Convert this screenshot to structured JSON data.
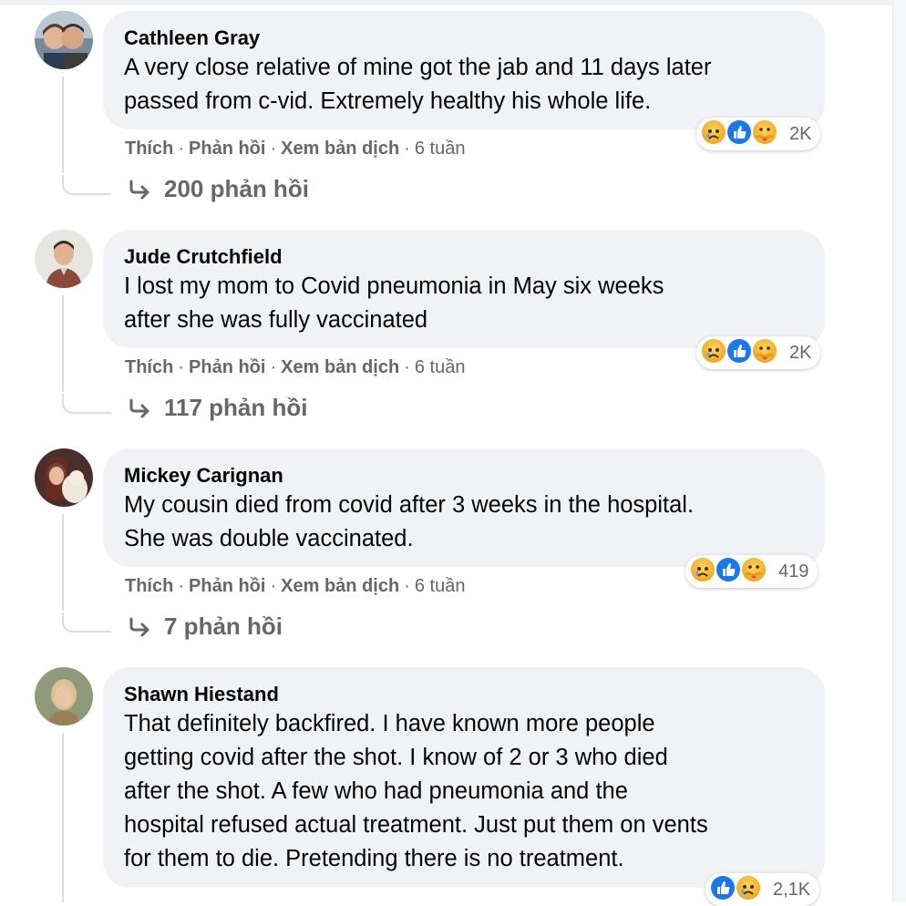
{
  "comments": [
    {
      "author": "Cathleen Gray",
      "lines": [
        "A very close relative of mine got the jab and 11 days later",
        "passed from c-vid. Extremely healthy his whole life."
      ],
      "actions": {
        "like": "Thích",
        "reply": "Phản hồi",
        "translate": "Xem bản dịch",
        "time": "6 tuần"
      },
      "reaction_count": "2K",
      "reaction_icons": [
        "sad-icon",
        "like-icon",
        "care-icon"
      ],
      "replies_label": "200 phản hồi"
    },
    {
      "author": "Jude Crutchfield",
      "lines": [
        "I lost my mom to Covid pneumonia in May six weeks",
        "after she was fully vaccinated"
      ],
      "actions": {
        "like": "Thích",
        "reply": "Phản hồi",
        "translate": "Xem bản dịch",
        "time": "6 tuần"
      },
      "reaction_count": "2K",
      "reaction_icons": [
        "sad-icon",
        "like-icon",
        "care-icon"
      ],
      "replies_label": "117 phản hồi"
    },
    {
      "author": "Mickey Carignan",
      "lines": [
        "My cousin died from covid after 3 weeks in the hospital.",
        "She was double vaccinated."
      ],
      "actions": {
        "like": "Thích",
        "reply": "Phản hồi",
        "translate": "Xem bản dịch",
        "time": "6 tuần"
      },
      "reaction_count": "419",
      "reaction_icons": [
        "sad-icon",
        "like-icon",
        "care-icon"
      ],
      "replies_label": "7 phản hồi"
    },
    {
      "author": "Shawn Hiestand",
      "lines": [
        "That definitely backfired. I have known more people",
        "getting covid after the shot. I know of 2 or 3 who died",
        "after the shot. A few who had pneumonia and the",
        "hospital refused actual treatment. Just put them on vents",
        "for them to die. Pretending there is no treatment."
      ],
      "reaction_count": "2,1K",
      "reaction_icons": [
        "like-icon",
        "sad-icon"
      ]
    }
  ],
  "colors": {
    "bubble": "#f0f2f5",
    "secondary_text": "#65676b",
    "like_blue": "#1877f2",
    "reaction_yellow": "#f7b928"
  }
}
